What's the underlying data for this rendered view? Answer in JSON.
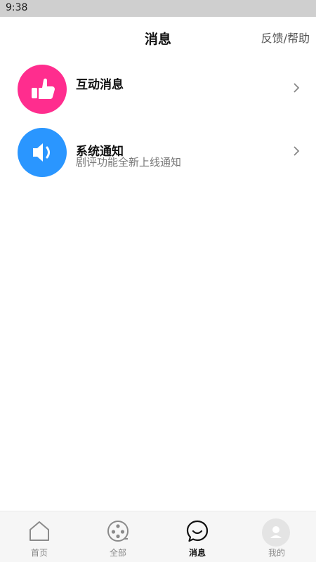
{
  "status_bar": {
    "time": "9:38"
  },
  "header": {
    "title": "消息",
    "help_label": "反馈/帮助"
  },
  "messages": [
    {
      "icon": "thumbs-up-icon",
      "title": "互动消息",
      "subtitle": "",
      "color": "#ff2d8e"
    },
    {
      "icon": "speaker-icon",
      "title": "系统通知",
      "subtitle": "剧评功能全新上线通知",
      "color": "#2a96ff"
    }
  ],
  "tabbar": {
    "active": "消息",
    "items": [
      {
        "label": "首页",
        "icon": "home-icon"
      },
      {
        "label": "全部",
        "icon": "film-reel-icon"
      },
      {
        "label": "消息",
        "icon": "chat-bubble-icon"
      },
      {
        "label": "我的",
        "icon": "avatar-icon"
      }
    ]
  }
}
